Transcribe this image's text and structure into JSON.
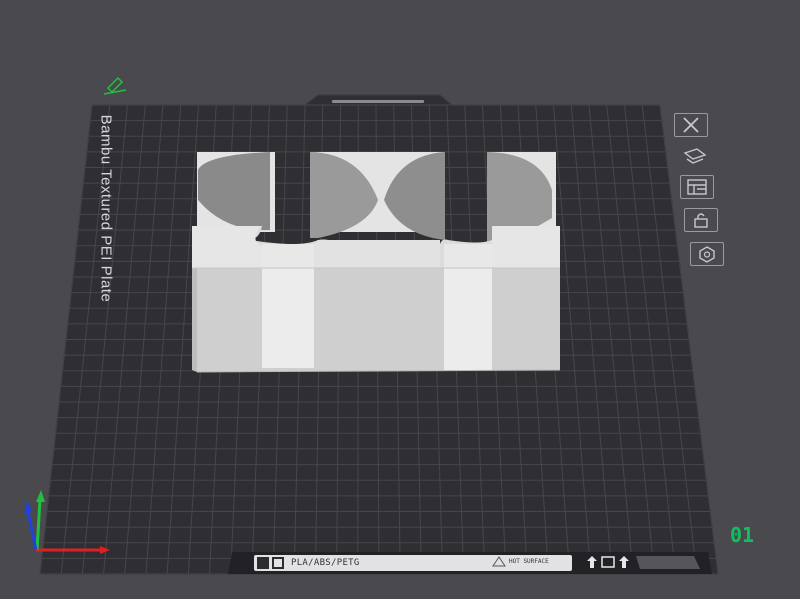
{
  "plate": {
    "name": "Bambu Textured PEI Plate",
    "number": "01",
    "label_strip": {
      "filament_types": "PLA/ABS/PETG",
      "warning": "HOT SURFACE"
    }
  },
  "toolbar": {
    "buttons": [
      {
        "name": "arrange-objects-button",
        "icon": "close-x-icon"
      },
      {
        "name": "auto-orient-button",
        "icon": "orient-icon"
      },
      {
        "name": "plate-settings-button",
        "icon": "layout-icon"
      },
      {
        "name": "lock-plate-button",
        "icon": "lock-icon"
      },
      {
        "name": "plate-options-button",
        "icon": "hexagon-settings-icon"
      }
    ]
  },
  "colors": {
    "background": "#4a4a4e",
    "plate": "#2f2f33",
    "grid": "#46464b",
    "model": "#e2e2e2",
    "plate_number": "#10c060",
    "axis_x": "#e02020",
    "axis_y": "#20c040",
    "axis_z": "#2040e0"
  }
}
